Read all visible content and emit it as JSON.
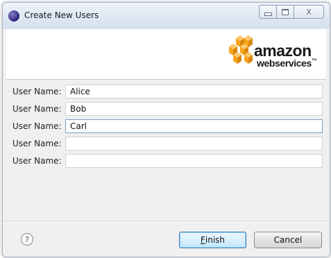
{
  "window": {
    "title": "Create New Users",
    "app_icon": "eclipse-icon",
    "controls": [
      "minimize-icon",
      "maximize-icon",
      "close-icon"
    ],
    "close_glyph": "X"
  },
  "banner": {
    "logo": {
      "name": "aws-logo",
      "wordmark_top": "amazon",
      "wordmark_bottom": "webservices",
      "trademark": "™",
      "brand_color": "#f7a51c"
    }
  },
  "form": {
    "rows": [
      {
        "label": "User Name:",
        "value": "Alice",
        "focused": false
      },
      {
        "label": "User Name:",
        "value": "Bob",
        "focused": false
      },
      {
        "label": "User Name:",
        "value": "Carl",
        "focused": true
      },
      {
        "label": "User Name:",
        "value": "",
        "focused": false
      },
      {
        "label": "User Name:",
        "value": "",
        "focused": false
      }
    ]
  },
  "footer": {
    "help_glyph": "?",
    "finish": {
      "mnemonic": "F",
      "rest": "inish"
    },
    "cancel_label": "Cancel"
  }
}
